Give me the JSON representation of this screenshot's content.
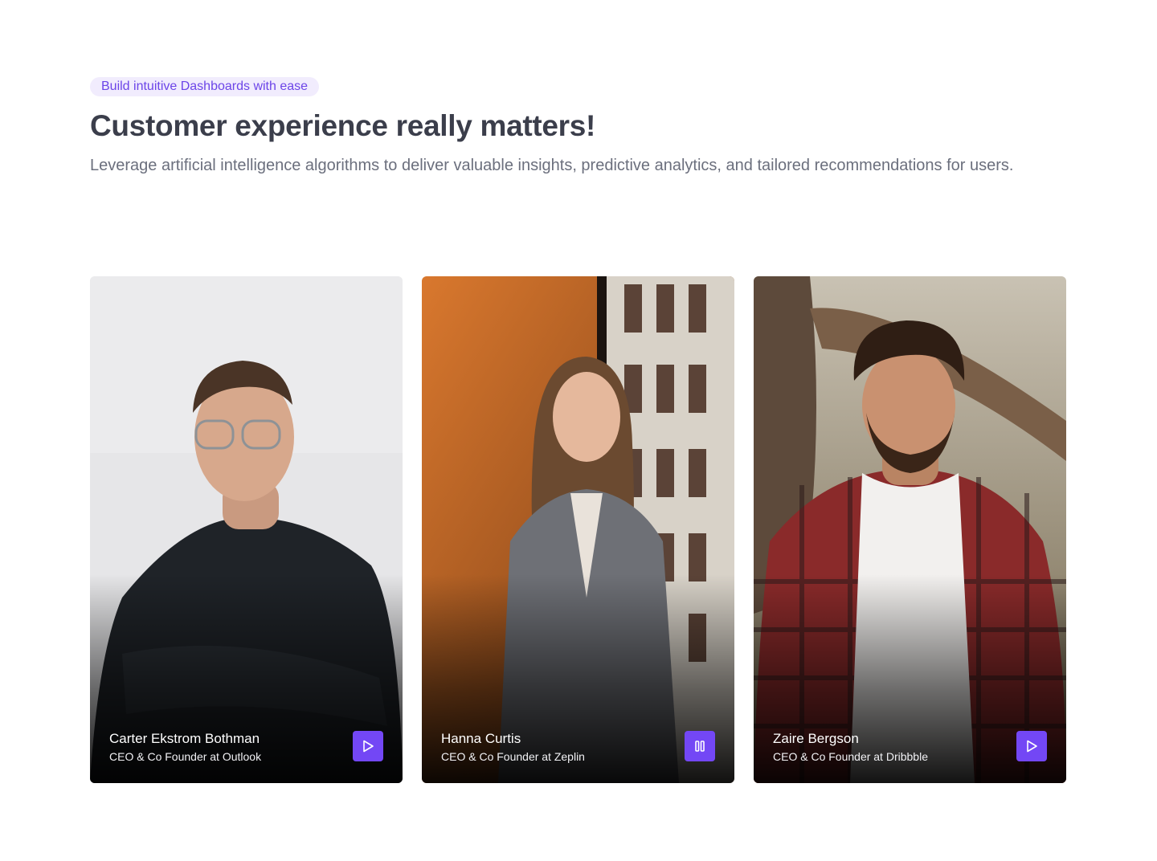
{
  "header": {
    "badge": "Build intuitive Dashboards with ease",
    "title": "Customer experience really matters!",
    "subtitle": "Leverage artificial intelligence algorithms to deliver valuable insights, predictive analytics, and tailored recommendations for users."
  },
  "colors": {
    "accent": "#7347f5",
    "badge_bg": "#f1ecfd",
    "badge_text": "#6c45e8"
  },
  "cards": [
    {
      "name": "Carter Ekstrom Bothman",
      "role": "CEO & Co Founder at Outlook",
      "control_icon": "play-icon"
    },
    {
      "name": "Hanna Curtis",
      "role": "CEO & Co Founder at Zeplin",
      "control_icon": "pause-icon"
    },
    {
      "name": "Zaire Bergson",
      "role": "CEO & Co Founder at Dribbble",
      "control_icon": "play-icon"
    }
  ]
}
